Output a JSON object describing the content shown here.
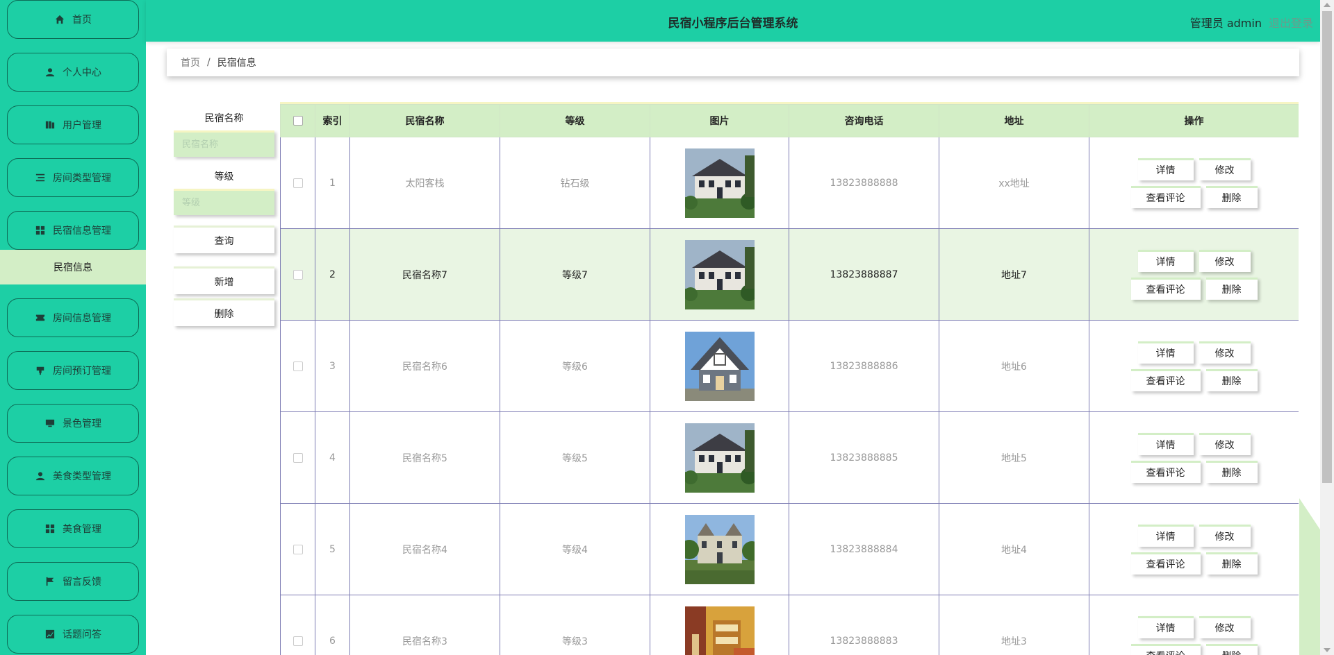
{
  "sidebar": {
    "items": [
      {
        "label": "首页",
        "icon": "home-icon"
      },
      {
        "label": "个人中心",
        "icon": "user-icon"
      },
      {
        "label": "用户管理",
        "icon": "book-icon"
      },
      {
        "label": "房间类型管理",
        "icon": "list-icon"
      },
      {
        "label": "民宿信息管理",
        "icon": "grid-icon"
      },
      {
        "label": "房间信息管理",
        "icon": "ticket-icon"
      },
      {
        "label": "房间预订管理",
        "icon": "stamp-icon"
      },
      {
        "label": "景色管理",
        "icon": "monitor-icon"
      },
      {
        "label": "美食类型管理",
        "icon": "user-icon"
      },
      {
        "label": "美食管理",
        "icon": "grid-icon"
      },
      {
        "label": "留言反馈",
        "icon": "flag-icon"
      },
      {
        "label": "话题问答",
        "icon": "chart-icon"
      }
    ],
    "submenu": {
      "label": "民宿信息"
    }
  },
  "header": {
    "title": "民宿小程序后台管理系统",
    "user": "管理员 admin",
    "logout": "退出登录"
  },
  "breadcrumb": {
    "home": "首页",
    "separator": "/",
    "current": "民宿信息"
  },
  "search": {
    "name_label": "民宿名称",
    "name_placeholder": "民宿名称",
    "grade_label": "等级",
    "grade_placeholder": "等级",
    "query_button": "查询",
    "add_button": "新增",
    "delete_button": "删除"
  },
  "table": {
    "headers": [
      "索引",
      "民宿名称",
      "等级",
      "图片",
      "咨询电话",
      "地址",
      "操作"
    ],
    "actions": {
      "detail": "详情",
      "edit": "修改",
      "comments": "查看评论",
      "delete": "删除"
    },
    "rows": [
      {
        "index": "1",
        "name": "太阳客栈",
        "grade": "钻石级",
        "phone": "13823888888",
        "address": "xx地址",
        "image": "house-colonial"
      },
      {
        "index": "2",
        "name": "民宿名称7",
        "grade": "等级7",
        "phone": "13823888887",
        "address": "地址7",
        "image": "house-colonial"
      },
      {
        "index": "3",
        "name": "民宿名称6",
        "grade": "等级6",
        "phone": "13823888886",
        "address": "地址6",
        "image": "house-gable"
      },
      {
        "index": "4",
        "name": "民宿名称5",
        "grade": "等级5",
        "phone": "13823888885",
        "address": "地址5",
        "image": "house-colonial"
      },
      {
        "index": "5",
        "name": "民宿名称4",
        "grade": "等级4",
        "phone": "13823888884",
        "address": "地址4",
        "image": "house-manor"
      },
      {
        "index": "6",
        "name": "民宿名称3",
        "grade": "等级3",
        "phone": "13823888883",
        "address": "地址3",
        "image": "room-interior"
      }
    ]
  },
  "colors": {
    "primary": "#1dcfa5",
    "accent_light": "#d3eec6",
    "row_highlight": "#e9f5e3",
    "table_border": "#7b7ab2"
  }
}
